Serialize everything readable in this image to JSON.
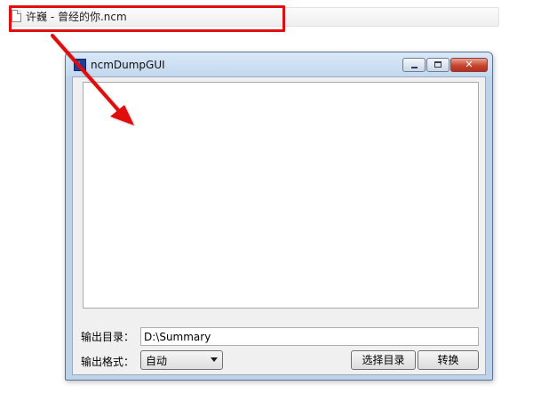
{
  "file_item": {
    "name": "许巍 - 曾经的你.ncm",
    "icon": "file-icon"
  },
  "annotation": {
    "highlight_color": "#e01010"
  },
  "window": {
    "title": "ncmDumpGUI",
    "icon": "app-icon",
    "controls": {
      "minimize_icon": "minimize-icon",
      "maximize_icon": "maximize-icon",
      "close_glyph": "✕"
    }
  },
  "form": {
    "log_text": "",
    "output_dir_label": "输出目录：",
    "output_dir_value": "D:\\Summary",
    "output_format_label": "输出格式：",
    "output_format_value": "自动",
    "choose_dir_button": "选择目录",
    "convert_button": "转换"
  }
}
